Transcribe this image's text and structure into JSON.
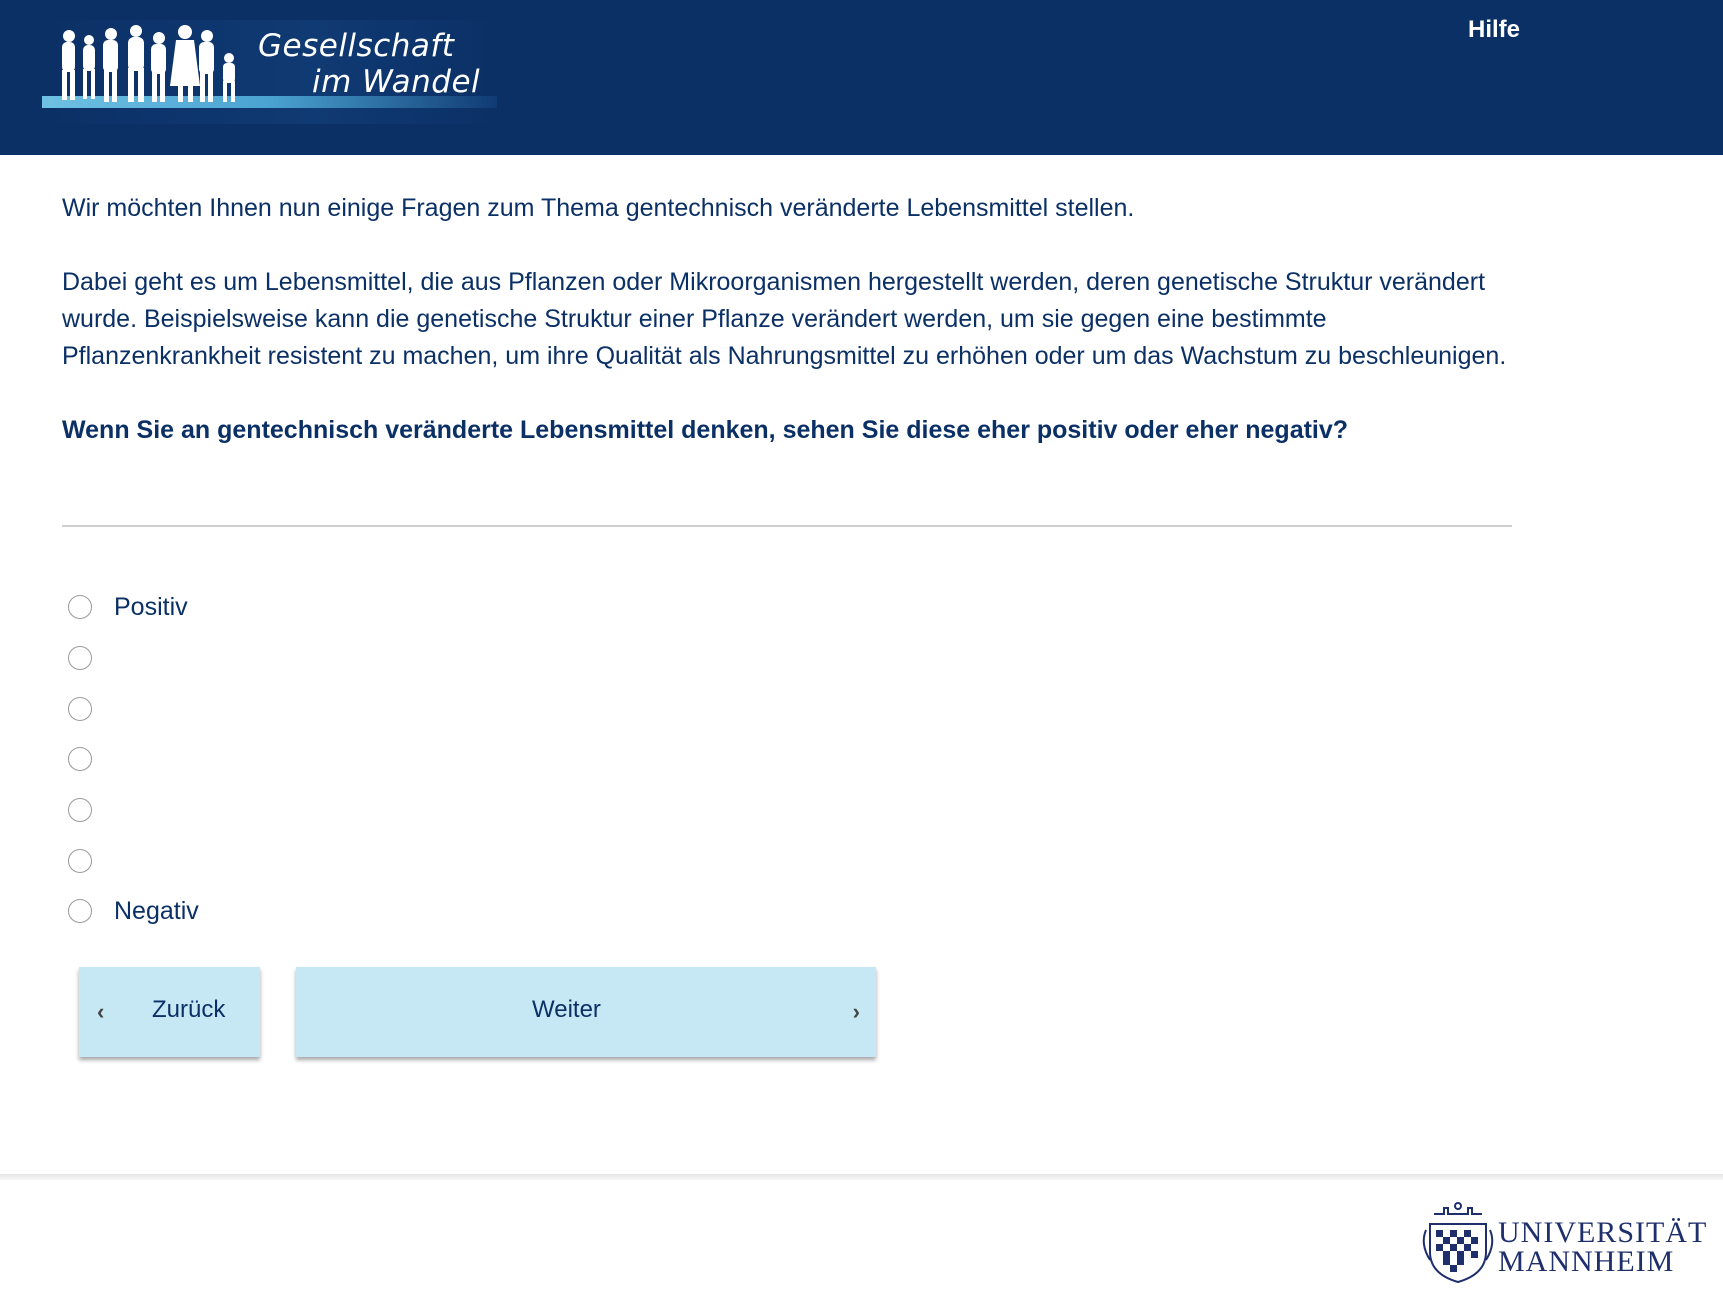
{
  "header": {
    "logo_line1": "Gesellschaft",
    "logo_line2": "im Wandel",
    "help_label": "Hilfe",
    "background_color": "#0b3066"
  },
  "intro": {
    "paragraph1": "Wir möchten Ihnen nun einige Fragen zum Thema gentechnisch veränderte Lebensmittel stellen.",
    "paragraph2": "Dabei geht es um Lebensmittel, die aus Pflanzen oder Mikroorganismen hergestellt werden, deren genetische Struktur verändert wurde. Beispielsweise kann die genetische Struktur einer Pflanze verändert werden, um sie gegen eine bestimmte Pflanzenkrankheit resistent zu machen, um ihre Qualität als Nahrungsmittel zu erhöhen oder um das Wachstum zu beschleunigen.",
    "question": "Wenn Sie an gentechnisch veränderte Lebensmittel denken, sehen Sie diese eher positiv oder eher negativ?"
  },
  "scale": {
    "options": [
      {
        "label": "Positiv"
      },
      {
        "label": ""
      },
      {
        "label": ""
      },
      {
        "label": ""
      },
      {
        "label": ""
      },
      {
        "label": ""
      },
      {
        "label": "Negativ"
      }
    ]
  },
  "nav": {
    "back_label": "Zurück",
    "next_label": "Weiter",
    "button_color": "#c6e8f5"
  },
  "footer": {
    "uni_line1": "UNIVERSITÄT",
    "uni_line2": "MANNHEIM"
  }
}
